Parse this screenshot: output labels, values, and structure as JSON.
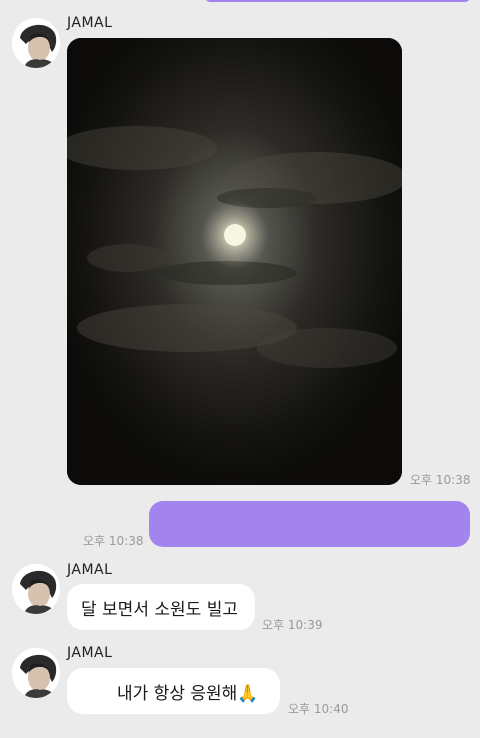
{
  "colors": {
    "background": "#ebebeb",
    "my_bubble": "#a384ef",
    "their_bubble": "#ffffff",
    "timestamp": "#9a9a9a"
  },
  "messages": [
    {
      "sender": "JAMAL",
      "kind": "photo",
      "photo_subject": "full moon behind clouds at night",
      "time": "오후 10:38"
    },
    {
      "sender": "me",
      "kind": "text",
      "text": "",
      "time": "오후 10:38"
    },
    {
      "sender": "JAMAL",
      "kind": "text",
      "text": "달 보면서 소원도 빌고",
      "time": "오후 10:39"
    },
    {
      "sender": "JAMAL",
      "kind": "text",
      "text": "내가 항상 응원해🙏",
      "time": "오후 10:40"
    }
  ]
}
